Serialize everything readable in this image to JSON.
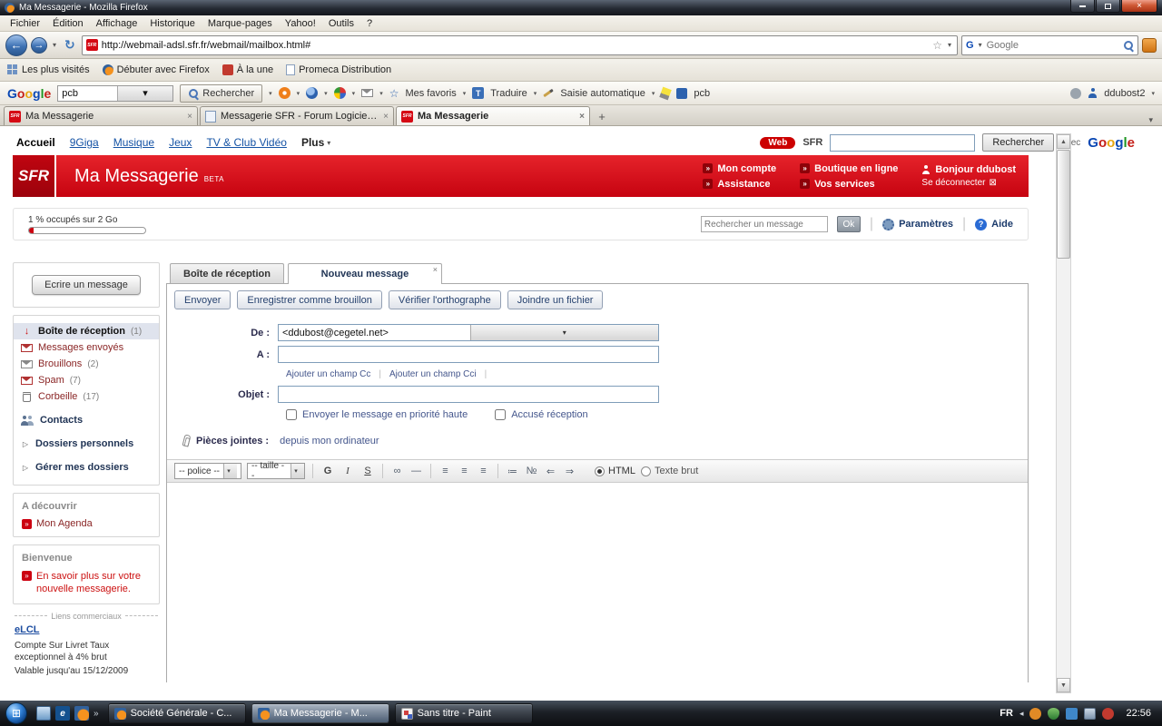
{
  "icons": {
    "close": "×",
    "dropdown": "▾",
    "back": "←",
    "forward": "→",
    "reload": "↻",
    "star": "☆",
    "new_tab": "+",
    "chevron": "»",
    "triangle": "▷",
    "up": "▲",
    "down": "▼",
    "inbox_arrow": "↓",
    "link": "∞",
    "hrule": "—",
    "align": "≡",
    "list_bullet": "≔",
    "list_number": "№",
    "outdent": "⇐",
    "indent": "⇒",
    "logout_box": "⊠",
    "start_flag": "⊞",
    "hidden_chevron": "◂",
    "question": "?"
  },
  "window": {
    "title": "Ma Messagerie - Mozilla Firefox",
    "menus": [
      "Fichier",
      "Édition",
      "Affichage",
      "Historique",
      "Marque-pages",
      "Yahoo!",
      "Outils",
      "?"
    ],
    "url": "http://webmail-adsl.sfr.fr/webmail/mailbox.html#",
    "search_placeholder": "Google"
  },
  "bookmarks": [
    "Les plus visités",
    "Débuter avec Firefox",
    "À la une",
    "Promeca Distribution"
  ],
  "browser_tabs": [
    {
      "label": "Ma Messagerie"
    },
    {
      "label": "Messagerie SFR - Forum Logiciel - S..."
    },
    {
      "label": "Ma Messagerie"
    }
  ],
  "google_toolbar": {
    "logo_letters": [
      "G",
      "o",
      "o",
      "g",
      "l",
      "e"
    ],
    "query": "pcb",
    "search_label": "Rechercher",
    "favorites": "Mes favoris",
    "translate": "Traduire",
    "translate_glyph": "T",
    "autofill": "Saisie automatique",
    "pcb": "pcb",
    "account": "ddubost2"
  },
  "site_nav": {
    "home": "Accueil",
    "links": [
      "9Giga",
      "Musique",
      "Jeux",
      "TV & Club Vidéo"
    ],
    "more": "Plus",
    "web_badge": "Web",
    "sfr": "SFR",
    "search_button": "Rechercher",
    "avec": "avec",
    "google_letters": [
      "G",
      "o",
      "o",
      "g",
      "l",
      "e"
    ]
  },
  "banner": {
    "logo": "SFR",
    "title": "Ma Messagerie",
    "beta": "BETA",
    "col1": [
      "Mon compte",
      "Assistance"
    ],
    "col2": [
      "Boutique en ligne",
      "Vos services"
    ],
    "greeting": "Bonjour ddubost",
    "logout": "Se déconnecter"
  },
  "toolbar_row": {
    "storage": "1 % occupés sur 2 Go",
    "search_placeholder": "Rechercher un message",
    "ok": "Ok",
    "settings": "Paramètres",
    "help": "Aide"
  },
  "sidebar": {
    "compose_button": "Ecrire un message",
    "folders": [
      {
        "label": "Boîte de réception",
        "count": "(1)"
      },
      {
        "label": "Messages envoyés",
        "count": ""
      },
      {
        "label": "Brouillons",
        "count": "(2)"
      },
      {
        "label": "Spam",
        "count": "(7)"
      },
      {
        "label": "Corbeille",
        "count": "(17)"
      }
    ],
    "contacts": "Contacts",
    "links": [
      "Dossiers personnels",
      "Gérer mes dossiers"
    ],
    "discover": {
      "title": "A découvrir",
      "item": "Mon Agenda"
    },
    "welcome": {
      "title": "Bienvenue",
      "link": "En savoir plus sur votre nouvelle messagerie."
    },
    "ads": {
      "title": "Liens commerciaux",
      "advertiser": "eLCL",
      "text": "Compte Sur Livret Taux exceptionnel à 4% brut",
      "validity": "Valable jusqu'au 15/12/2009"
    }
  },
  "mail": {
    "tabs": [
      {
        "label": "Boîte de réception"
      },
      {
        "label": "Nouveau message"
      }
    ],
    "actions": [
      "Envoyer",
      "Enregistrer comme brouillon",
      "Vérifier l'orthographe",
      "Joindre un fichier"
    ],
    "from_label": "De :",
    "from_value": "<ddubost@cegetel.net>",
    "to_label": "A :",
    "add_cc": "Ajouter un champ Cc",
    "add_cci": "Ajouter un champ Cci",
    "subject_label": "Objet :",
    "priority": "Envoyer le message en priorité haute",
    "receipt": "Accusé réception",
    "attachments_label": "Pièces jointes :",
    "attachments_source": "depuis mon ordinateur",
    "editor": {
      "font": "-- police --",
      "size": "-- taille --",
      "bold": "G",
      "italic": "I",
      "underline": "S",
      "mode_html": "HTML",
      "mode_plain": "Texte brut"
    }
  },
  "taskbar": {
    "windows": [
      {
        "label": "Société Générale - C..."
      },
      {
        "label": "Ma Messagerie - M..."
      },
      {
        "label": "Sans titre - Paint"
      }
    ],
    "lang": "FR",
    "time": "22:56"
  }
}
